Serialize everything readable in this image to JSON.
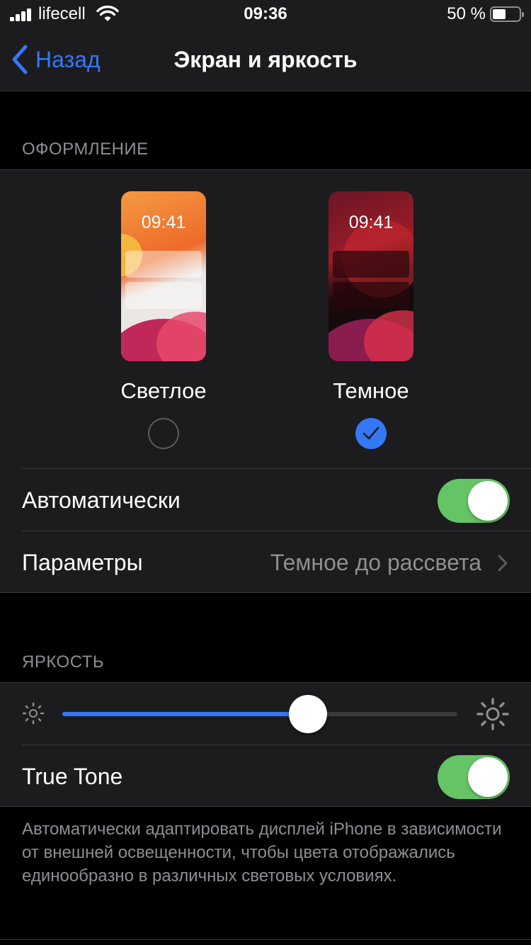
{
  "status_bar": {
    "carrier": "lifecell",
    "time": "09:36",
    "battery_percent": "50 %",
    "battery_level": 0.5
  },
  "nav": {
    "back_label": "Назад",
    "title": "Экран и яркость"
  },
  "appearance": {
    "header": "ОФОРМЛЕНИЕ",
    "options": [
      {
        "label": "Светлое",
        "preview_time": "09:41",
        "selected": false
      },
      {
        "label": "Темное",
        "preview_time": "09:41",
        "selected": true
      }
    ],
    "automatic_label": "Автоматически",
    "automatic_on": true,
    "options_label": "Параметры",
    "options_value": "Темное до рассвета"
  },
  "brightness": {
    "header": "ЯРКОСТЬ",
    "level": 0.622,
    "true_tone_label": "True Tone",
    "true_tone_on": true,
    "true_tone_note": "Автоматически адаптировать дисплей iPhone в зависимости от внешней освещенности, чтобы цвета отображались единообразно в различных световых условиях."
  },
  "colors": {
    "accent": "#3478f6",
    "toggle_on": "#65c466",
    "background": "#000000",
    "cell_background": "#1c1c1e",
    "secondary_text": "#8e8e93"
  }
}
